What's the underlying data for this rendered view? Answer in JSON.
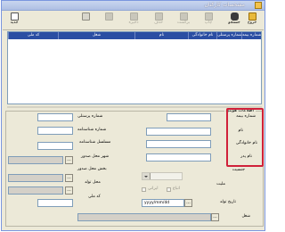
{
  "window": {
    "title": "مشخصات کارکنان"
  },
  "toolbar": {
    "exit_label": "خروج",
    "search_label": "جستجو",
    "save_label": "ذخیره",
    "undo_label": "",
    "new_label": "جدید",
    "disabled_labels": [
      "چاپ",
      "برگشت",
      "حذف"
    ]
  },
  "grid": {
    "columns": [
      "شماره بیمه",
      "شماره پرسنلی",
      "نام خانوادگی",
      "نام",
      "شغل",
      "کد ملی"
    ]
  },
  "identity": {
    "group_title": "اطلاعات هویتی",
    "insurance_no_label": "شماره بیمه",
    "first_name_label": "نام",
    "last_name_label": "نام خانوادگی",
    "father_name_label": "نام پدر",
    "personnel_no_label": "شماره پرسنلی",
    "id_card_no_label": "شماره شناسنامه",
    "id_card_serial_label": "مسلسل شناسنامه",
    "issue_city_label": "شهر محل صدور",
    "issue_section_label": "بخش محل صدور",
    "birth_place_label": "محل تولد",
    "national_code_label": "کد ملی",
    "gender_label": "جنسیت",
    "nationality_label": "ملیت",
    "foreign_national_label": "اتباع",
    "iranian_label": "ایرانی",
    "birth_date_label": "تاریخ تولد",
    "birth_date_value": "yyyy/mm/dd",
    "job_label": "شغل",
    "browse_glyph": "..."
  }
}
